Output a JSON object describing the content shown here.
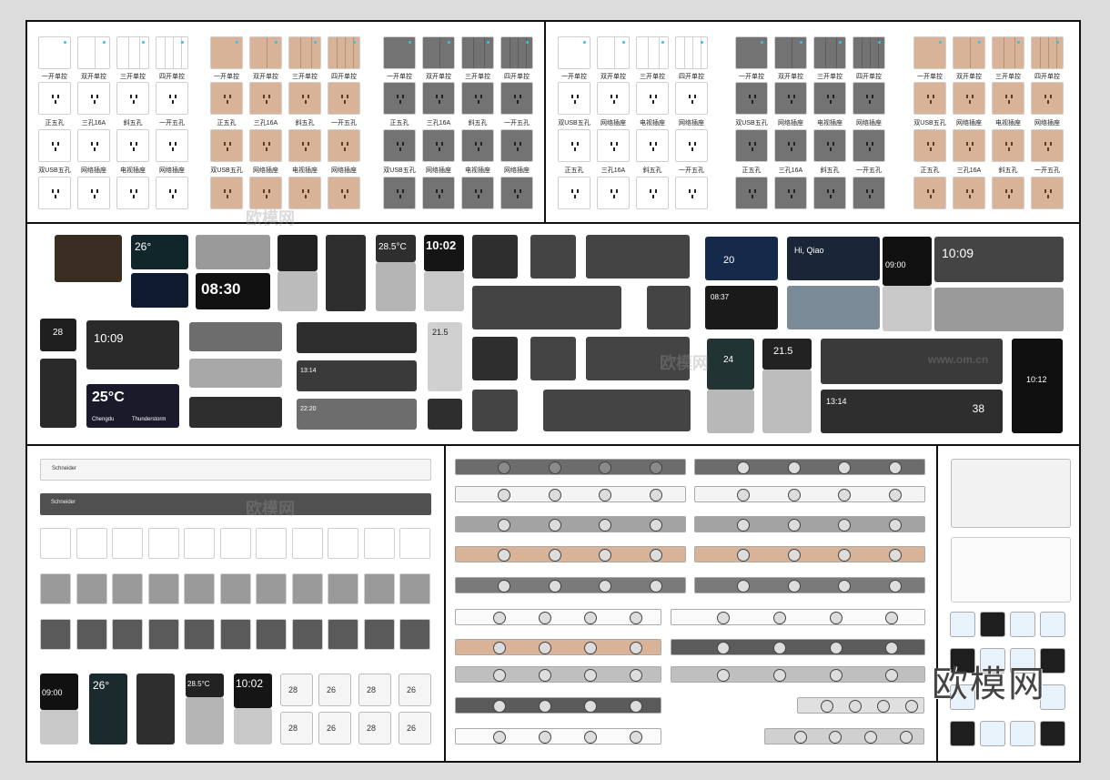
{
  "brand": {
    "name": "欧模网",
    "watermark": "欧模网",
    "url_watermark": "www.om.cn"
  },
  "colors": {
    "white": "#ffffff",
    "beige": "#d8b397",
    "grey": "#737373",
    "dark": "#2c2c2c",
    "accent": "#35c3e6"
  },
  "panel_groups": [
    {
      "name": "white",
      "row_labels": [
        [
          "一开单控",
          "双开单控",
          "三开单控",
          "四开单控"
        ],
        [
          "正五孔",
          "三孔16A",
          "斜五孔",
          "一开五孔"
        ],
        [
          "双USB五孔",
          "网络插座",
          "电视插座",
          "网络插座"
        ]
      ]
    },
    {
      "name": "beige",
      "row_labels": [
        [
          "一开单控",
          "双开单控",
          "三开单控",
          "四开单控"
        ],
        [
          "正五孔",
          "三孔16A",
          "斜五孔",
          "一开五孔"
        ],
        [
          "双USB五孔",
          "网络插座",
          "电视插座",
          "网络插座"
        ]
      ]
    },
    {
      "name": "grey",
      "row_labels": [
        [
          "一开单控",
          "双开单控",
          "三开单控",
          "四开单控"
        ],
        [
          "正五孔",
          "三孔16A",
          "斜五孔",
          "一开五孔"
        ],
        [
          "双USB五孔",
          "网络插座",
          "电视插座",
          "网络插座"
        ]
      ]
    },
    {
      "name": "white2",
      "row_labels": [
        [
          "一开单控",
          "双开单控",
          "三开单控",
          "四开单控"
        ],
        [
          "双USB五孔",
          "网络插座",
          "电视插座",
          "网络插座"
        ],
        [
          "正五孔",
          "三孔16A",
          "斜五孔",
          "一开五孔"
        ]
      ]
    },
    {
      "name": "grey2",
      "row_labels": [
        [
          "一开单控",
          "双开单控",
          "三开单控",
          "四开单控"
        ],
        [
          "双USB五孔",
          "网络插座",
          "电视插座",
          "网络插座"
        ],
        [
          "正五孔",
          "三孔16A",
          "斜五孔",
          "一开五孔"
        ]
      ]
    },
    {
      "name": "beige2",
      "row_labels": [
        [
          "一开单控",
          "双开单控",
          "三开单控",
          "四开单控"
        ],
        [
          "双USB五孔",
          "网络插座",
          "电视插座",
          "网络插座"
        ],
        [
          "正五孔",
          "三孔16A",
          "斜五孔",
          "一开五孔"
        ]
      ]
    }
  ],
  "smart_screens": {
    "temp_26": "26°",
    "clock_0830": "08:30",
    "temp_285": "28.5°C",
    "clock_1002": "10:02",
    "num_28": "28",
    "clock_1009": "10:09",
    "weather_temp": "25°C",
    "weather_city": "Chengdu",
    "weather_state": "Thunderstorm",
    "num_215": "21.5",
    "clock_1314": "13:14",
    "clock_2220": "22:20",
    "num_38": "38",
    "greeting": "Hi, Qiao",
    "clock_0900": "09:00",
    "temp_20": "20",
    "clock_0837": "08:37",
    "num_24": "24",
    "clock_1012": "10:12"
  },
  "track_labels": {
    "schneider": "Schneider"
  },
  "thermostat_values": [
    "28",
    "26",
    "28",
    "26"
  ]
}
